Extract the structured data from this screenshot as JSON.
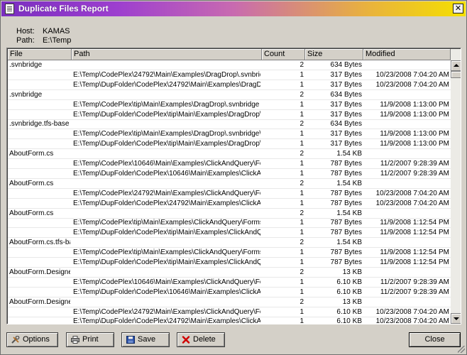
{
  "window": {
    "title": "Duplicate Files Report",
    "close_glyph": "✕"
  },
  "info": {
    "host_label": "Host:",
    "host_value": "KAMAS",
    "path_label": "Path:",
    "path_value": "E:\\Temp"
  },
  "columns": {
    "file": "File",
    "path": "Path",
    "count": "Count",
    "size": "Size",
    "modified": "Modified"
  },
  "rows": [
    {
      "file": ".svnbridge",
      "path": "",
      "count": "2",
      "size": "634 Bytes",
      "modified": ""
    },
    {
      "file": "",
      "path": "E:\\Temp\\CodePlex\\24792\\Main\\Examples\\DragDrop\\.svnbridge",
      "count": "1",
      "size": "317 Bytes",
      "modified": "10/23/2008 7:04:20 AM"
    },
    {
      "file": "",
      "path": "E:\\Temp\\DupFolder\\CodePlex\\24792\\Main\\Examples\\DragDrop...",
      "count": "1",
      "size": "317 Bytes",
      "modified": "10/23/2008 7:04:20 AM"
    },
    {
      "file": ".svnbridge",
      "path": "",
      "count": "2",
      "size": "634 Bytes",
      "modified": ""
    },
    {
      "file": "",
      "path": "E:\\Temp\\CodePlex\\tip\\Main\\Examples\\DragDrop\\.svnbridge",
      "count": "1",
      "size": "317 Bytes",
      "modified": "11/9/2008 1:13:00 PM"
    },
    {
      "file": "",
      "path": "E:\\Temp\\DupFolder\\CodePlex\\tip\\Main\\Examples\\DragDrop\\.s...",
      "count": "1",
      "size": "317 Bytes",
      "modified": "11/9/2008 1:13:00 PM"
    },
    {
      "file": ".svnbridge.tfs-base",
      "path": "",
      "count": "2",
      "size": "634 Bytes",
      "modified": ""
    },
    {
      "file": "",
      "path": "E:\\Temp\\CodePlex\\tip\\Main\\Examples\\DragDrop\\.svnbridge\\_tf...",
      "count": "1",
      "size": "317 Bytes",
      "modified": "11/9/2008 1:13:00 PM"
    },
    {
      "file": "",
      "path": "E:\\Temp\\DupFolder\\CodePlex\\tip\\Main\\Examples\\DragDrop\\.s...",
      "count": "1",
      "size": "317 Bytes",
      "modified": "11/9/2008 1:13:00 PM"
    },
    {
      "file": "AboutForm.cs",
      "path": "",
      "count": "2",
      "size": "1.54 KB",
      "modified": ""
    },
    {
      "file": "",
      "path": "E:\\Temp\\CodePlex\\10646\\Main\\Examples\\ClickAndQuery\\Forms",
      "count": "1",
      "size": "787 Bytes",
      "modified": "11/2/2007 9:28:39 AM"
    },
    {
      "file": "",
      "path": "E:\\Temp\\DupFolder\\CodePlex\\10646\\Main\\Examples\\ClickAnd...",
      "count": "1",
      "size": "787 Bytes",
      "modified": "11/2/2007 9:28:39 AM"
    },
    {
      "file": "AboutForm.cs",
      "path": "",
      "count": "2",
      "size": "1.54 KB",
      "modified": ""
    },
    {
      "file": "",
      "path": "E:\\Temp\\CodePlex\\24792\\Main\\Examples\\ClickAndQuery\\Forms",
      "count": "1",
      "size": "787 Bytes",
      "modified": "10/23/2008 7:04:20 AM"
    },
    {
      "file": "",
      "path": "E:\\Temp\\DupFolder\\CodePlex\\24792\\Main\\Examples\\ClickAnd...",
      "count": "1",
      "size": "787 Bytes",
      "modified": "10/23/2008 7:04:20 AM"
    },
    {
      "file": "AboutForm.cs",
      "path": "",
      "count": "2",
      "size": "1.54 KB",
      "modified": ""
    },
    {
      "file": "",
      "path": "E:\\Temp\\CodePlex\\tip\\Main\\Examples\\ClickAndQuery\\Forms",
      "count": "1",
      "size": "787 Bytes",
      "modified": "11/9/2008 1:12:54 PM"
    },
    {
      "file": "",
      "path": "E:\\Temp\\DupFolder\\CodePlex\\tip\\Main\\Examples\\ClickAndQuer...",
      "count": "1",
      "size": "787 Bytes",
      "modified": "11/9/2008 1:12:54 PM"
    },
    {
      "file": "AboutForm.cs.tfs-ba...",
      "path": "",
      "count": "2",
      "size": "1.54 KB",
      "modified": ""
    },
    {
      "file": "",
      "path": "E:\\Temp\\CodePlex\\tip\\Main\\Examples\\ClickAndQuery\\Forms\\_tf...",
      "count": "1",
      "size": "787 Bytes",
      "modified": "11/9/2008 1:12:54 PM"
    },
    {
      "file": "",
      "path": "E:\\Temp\\DupFolder\\CodePlex\\tip\\Main\\Examples\\ClickAndQuer...",
      "count": "1",
      "size": "787 Bytes",
      "modified": "11/9/2008 1:12:54 PM"
    },
    {
      "file": "AboutForm.Designe...",
      "path": "",
      "count": "2",
      "size": "13 KB",
      "modified": ""
    },
    {
      "file": "",
      "path": "E:\\Temp\\CodePlex\\10646\\Main\\Examples\\ClickAndQuery\\Forms",
      "count": "1",
      "size": "6.10 KB",
      "modified": "11/2/2007 9:28:39 AM"
    },
    {
      "file": "",
      "path": "E:\\Temp\\DupFolder\\CodePlex\\10646\\Main\\Examples\\ClickAnd...",
      "count": "1",
      "size": "6.10 KB",
      "modified": "11/2/2007 9:28:39 AM"
    },
    {
      "file": "AboutForm.Designe...",
      "path": "",
      "count": "2",
      "size": "13 KB",
      "modified": ""
    },
    {
      "file": "",
      "path": "E:\\Temp\\CodePlex\\24792\\Main\\Examples\\ClickAndQuery\\Forms",
      "count": "1",
      "size": "6.10 KB",
      "modified": "10/23/2008 7:04:20 AM"
    },
    {
      "file": "",
      "path": "E:\\Temp\\DupFolder\\CodePlex\\24792\\Main\\Examples\\ClickAnd...",
      "count": "1",
      "size": "6.10 KB",
      "modified": "10/23/2008 7:04:20 AM"
    }
  ],
  "buttons": {
    "options": "Options",
    "print": "Print",
    "save": "Save",
    "delete": "Delete",
    "close": "Close"
  },
  "icons": {
    "options": "tools-icon",
    "print": "printer-icon",
    "save": "floppy-disk-icon",
    "delete": "red-x-icon"
  },
  "colors": {
    "title_start": "#7a2ec0",
    "title_end": "#f5e000",
    "delete_red": "#d00000"
  }
}
